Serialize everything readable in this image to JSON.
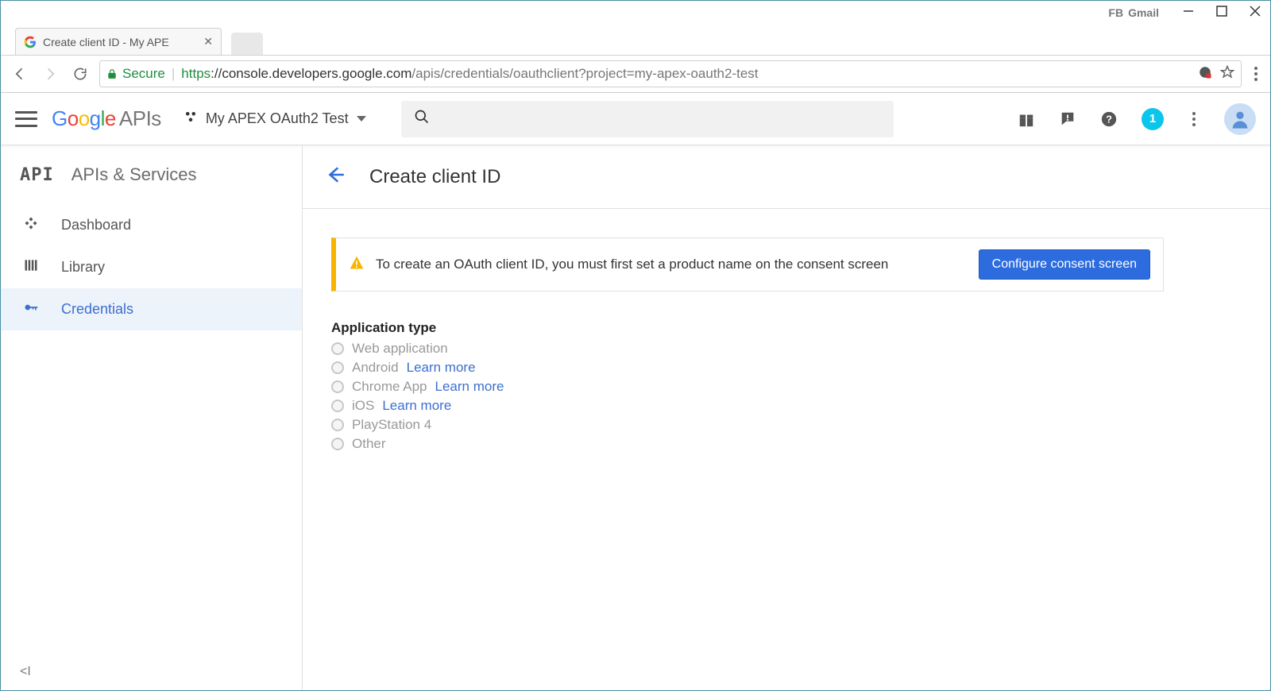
{
  "window": {
    "bookmarks": {
      "fb": "FB",
      "gmail": "Gmail"
    }
  },
  "tab": {
    "title": "Create client ID - My APE"
  },
  "addr": {
    "secure_label": "Secure",
    "url_scheme": "https",
    "url_host": "://console.developers.google.com",
    "url_path": "/apis/credentials/oauthclient?project=my-apex-oauth2-test"
  },
  "header": {
    "apis_label": "APIs",
    "project_name": "My APEX OAuth2 Test",
    "notification_count": "1"
  },
  "sidebar": {
    "title": "APIs & Services",
    "api_mark": "API",
    "items": [
      {
        "label": "Dashboard"
      },
      {
        "label": "Library"
      },
      {
        "label": "Credentials"
      }
    ],
    "collapse": "<I"
  },
  "page": {
    "title": "Create client ID",
    "warning": "To create an OAuth client ID, you must first set a product name on the consent screen",
    "configure_button": "Configure consent screen",
    "apptype_heading": "Application type",
    "types": [
      {
        "label": "Web application",
        "learn": ""
      },
      {
        "label": "Android",
        "learn": "Learn more"
      },
      {
        "label": "Chrome App",
        "learn": "Learn more"
      },
      {
        "label": "iOS",
        "learn": "Learn more"
      },
      {
        "label": "PlayStation 4",
        "learn": ""
      },
      {
        "label": "Other",
        "learn": ""
      }
    ]
  }
}
